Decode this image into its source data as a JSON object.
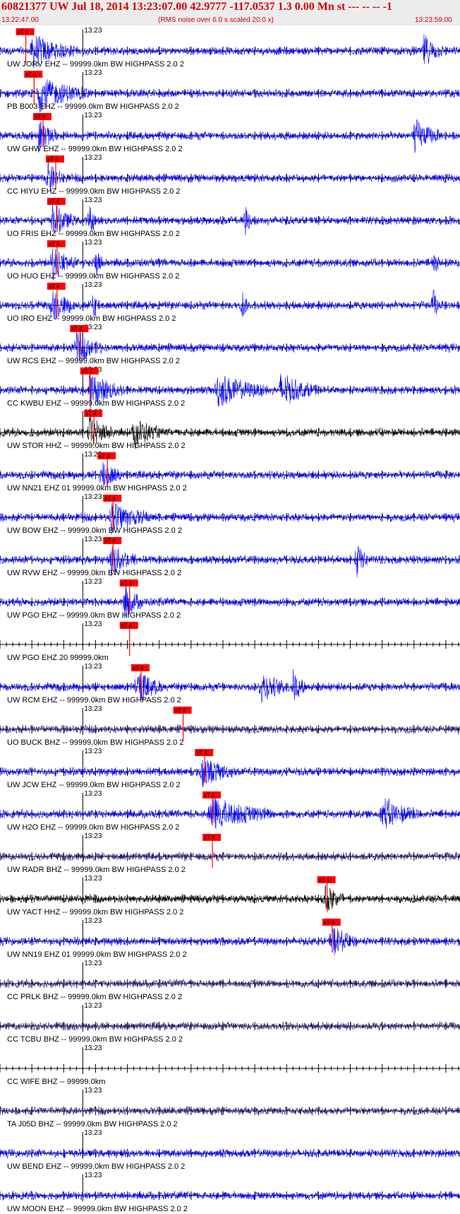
{
  "header": {
    "title": "60821377 UW Jul 18, 2014 13:23:07.00   42.9777 -117.0537  1.3 0.00 Mn st --- -- --  -1",
    "time_start": "13:22:47.00",
    "rms_note": "(RMS noise over 6.0 s scaled 20.0 x)",
    "time_end": "13:23:59.00"
  },
  "colors": {
    "header_bg": "#ececec",
    "header_text": "#d40000",
    "pick": "#ff0000",
    "blue": "#0000ff",
    "black": "#000000",
    "navy": "#2a1a7a"
  },
  "chart_data": {
    "type": "line",
    "description_units": "seconds after 13:22:47.00",
    "x_range_seconds": [
      0,
      72
    ],
    "minute_tick_label": "13:23",
    "pick_label": "xT 4",
    "traces": [
      {
        "label": "UW JORV EHZ -- 99999.0km BW  HIGHPASS  2.0  2",
        "color": "blue",
        "pick_s": 2.5,
        "bursts": [
          [
            5,
            3.5
          ],
          [
            66.5,
            1.5
          ]
        ]
      },
      {
        "label": "PB B003 EHZ -- 99999.0km BW  HIGHPASS  2.0  2",
        "color": "blue",
        "pick_s": 3.8,
        "bursts": [
          [
            6,
            4
          ]
        ]
      },
      {
        "label": "UW GHW EHZ -- 99999.0km BW  HIGHPASS  2.0  2",
        "color": "blue",
        "pick_s": 5.2,
        "bursts": [
          [
            6,
            1.5
          ],
          [
            65,
            2
          ]
        ]
      },
      {
        "label": "CC HIYU EHZ -- 99999.0km BW  HIGHPASS  2.0  2",
        "color": "blue",
        "pick_s": 7.2,
        "bursts": [
          [
            7.5,
            1.2
          ]
        ]
      },
      {
        "label": "UO FRIS EHZ -- 99999.0km BW  HIGHPASS  2.0  2",
        "color": "blue",
        "pick_s": 7.4,
        "bursts": [
          [
            8.2,
            1.8
          ],
          [
            14,
            0.6
          ],
          [
            38.5,
            0.5
          ]
        ]
      },
      {
        "label": "UO HUO EHZ -- 99999.0km BW  HIGHPASS  2.0  2",
        "color": "blue",
        "pick_s": 7.4,
        "bursts": [
          [
            8.2,
            1.8
          ],
          [
            15,
            0.6
          ],
          [
            68,
            0.5
          ]
        ]
      },
      {
        "label": "UO IRO EHZ -- 99999.0km BW  HIGHPASS  2.0  2",
        "color": "blue",
        "pick_s": 7.4,
        "bursts": [
          [
            8.2,
            1.8
          ],
          [
            14.5,
            0.6
          ],
          [
            38,
            0.5
          ],
          [
            68,
            0.5
          ]
        ]
      },
      {
        "label": "UW RCS EHZ -- 99999.0km BW  HIGHPASS  2.0  2",
        "color": "blue",
        "pick_s": 11.0,
        "bursts": [
          [
            12,
            2
          ]
        ]
      },
      {
        "label": "CC KWBU EHZ -- 99999.0km BW  HIGHPASS  2.0  2",
        "color": "blue",
        "pick_s": 12.6,
        "bursts": [
          [
            14,
            3
          ],
          [
            34,
            4
          ],
          [
            44,
            3
          ]
        ]
      },
      {
        "label": "UW STOR HHZ -- 99999.0km BW  HIGHPASS  2.0  2",
        "color": "black",
        "pick_s": 13.2,
        "bursts": [
          [
            14,
            2
          ],
          [
            21,
            2
          ]
        ]
      },
      {
        "label": "UW NN21 EHZ 01 99999.0km BW  HIGHPASS  2.0  2",
        "color": "blue",
        "pick_s": 15.3,
        "bursts": [
          [
            16,
            1.5
          ]
        ]
      },
      {
        "label": "UW BOW EHZ -- 99999.0km BW  HIGHPASS  2.0  2",
        "color": "blue",
        "pick_s": 16.2,
        "bursts": [
          [
            17.5,
            3
          ]
        ]
      },
      {
        "label": "UW RVW EHZ -- 99999.0km BW  HIGHPASS  2.0  2",
        "color": "blue",
        "pick_s": 16.2,
        "bursts": [
          [
            17.5,
            2
          ],
          [
            56,
            1
          ]
        ]
      },
      {
        "label": "UW PGO EHZ -- 99999.0km BW  HIGHPASS  2.0  2",
        "color": "blue",
        "pick_s": 18.8,
        "bursts": [
          [
            19.5,
            1.5
          ]
        ]
      },
      {
        "label": "UW PGO EHZ 20 99999.0km",
        "color": "none",
        "pick_s": 18.8,
        "bursts": []
      },
      {
        "label": "UW RCM EHZ -- 99999.0km BW  HIGHPASS  2.0  2",
        "color": "blue",
        "pick_s": 20.6,
        "bursts": [
          [
            21.5,
            2
          ],
          [
            41,
            2
          ],
          [
            46,
            1
          ]
        ]
      },
      {
        "label": "UO BUCK BHZ -- 99999.0km BW  HIGHPASS  2.0  2",
        "color": "navy",
        "pick_s": 27.2,
        "bursts": []
      },
      {
        "label": "UW JCW EHZ -- 99999.0km BW  HIGHPASS  2.0  2",
        "color": "blue",
        "pick_s": 30.6,
        "bursts": [
          [
            31.5,
            2.5
          ]
        ]
      },
      {
        "label": "UW H2O EHZ -- 99999.0km BW  HIGHPASS  2.0  2",
        "color": "blue",
        "pick_s": 31.8,
        "bursts": [
          [
            33,
            5
          ],
          [
            60,
            3
          ]
        ]
      },
      {
        "label": "UW RADR BHZ -- 99999.0km BW  HIGHPASS  2.0  2",
        "color": "navy",
        "pick_s": 31.8,
        "bursts": []
      },
      {
        "label": "UW YACT HHZ -- 99999.0km BW  HIGHPASS  2.0  2",
        "color": "black",
        "pick_s": 49.8,
        "bursts": [
          [
            51,
            1.5
          ]
        ]
      },
      {
        "label": "UW NN19 EHZ 01 99999.0km BW  HIGHPASS  2.0  2",
        "color": "blue",
        "pick_s": 50.6,
        "bursts": [
          [
            52,
            2
          ]
        ]
      },
      {
        "label": "CC PRLK BHZ -- 99999.0km BW  HIGHPASS  2.0  2",
        "color": "navy",
        "pick_s": null,
        "bursts": []
      },
      {
        "label": "CC TCBU BHZ -- 99999.0km BW  HIGHPASS  2.0  2",
        "color": "navy",
        "pick_s": null,
        "bursts": []
      },
      {
        "label": "CC WIFE BHZ -- 99999.0km",
        "color": "none",
        "pick_s": null,
        "bursts": []
      },
      {
        "label": "TA J05D BHZ -- 99999.0km BW  HIGHPASS  2.0  2",
        "color": "navy",
        "pick_s": null,
        "bursts": []
      },
      {
        "label": "UW BEND EHZ -- 99999.0km BW  HIGHPASS  2.0  2",
        "color": "blue",
        "pick_s": null,
        "bursts": []
      },
      {
        "label": "UW MOON EHZ -- 99999.0km BW  HIGHPASS  2.0  2",
        "color": "blue",
        "pick_s": null,
        "bursts": []
      }
    ]
  }
}
